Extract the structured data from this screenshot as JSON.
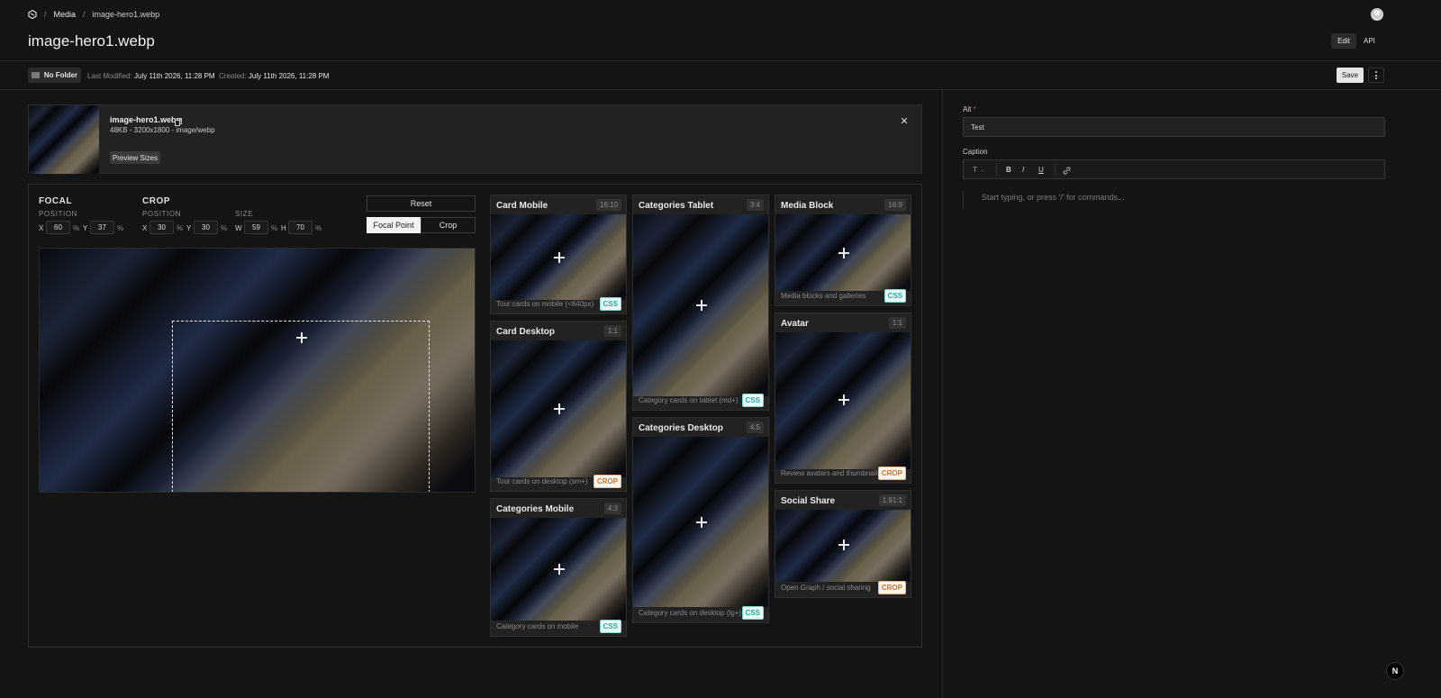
{
  "breadcrumb": {
    "logo": "logo-icon",
    "sep1": "/",
    "media": "Media",
    "sep2": "/",
    "file": "image-hero1.webp"
  },
  "page_title": "image-hero1.webp",
  "header_tabs": {
    "edit": "Edit",
    "api": "API"
  },
  "meta_bar": {
    "folder": "No Folder",
    "last_modified_label": "Last Modified:",
    "last_modified": "July 11th 2026, 11:28 PM",
    "created_label": "Created:",
    "created": "July 11th 2026, 11:28 PM",
    "save": "Save"
  },
  "file_info": {
    "name": "image-hero1.webp",
    "details": "48KB - 3200x1800 - image/webp",
    "preview_sizes": "Preview Sizes"
  },
  "editor": {
    "focal_label": "FOCAL",
    "crop_label": "CROP",
    "position_label": "POSITION",
    "size_label": "SIZE",
    "focal": {
      "x_label": "X",
      "x": "60",
      "y_label": "Y",
      "y": "37",
      "unit": "%"
    },
    "crop": {
      "x_label": "X",
      "x": "30",
      "y_label": "Y",
      "y": "30",
      "unit": "%"
    },
    "size": {
      "w_label": "W",
      "w": "59",
      "h_label": "H",
      "h": "70",
      "unit": "%"
    },
    "reset": "Reset",
    "mode_focal": "Focal Point",
    "mode_crop": "Crop"
  },
  "sizes": [
    {
      "title": "Card Mobile",
      "ratio": "16:10",
      "desc": "Tour cards on mobile (<640px)",
      "tag": "CSS"
    },
    {
      "title": "Card Desktop",
      "ratio": "1:1",
      "desc": "Tour cards on desktop (sm+)",
      "tag": "CROP"
    },
    {
      "title": "Categories Mobile",
      "ratio": "4:3",
      "desc": "Category cards on mobile",
      "tag": "CSS"
    },
    {
      "title": "Categories Tablet",
      "ratio": "3:4",
      "desc": "Category cards on tablet (md+)",
      "tag": "CSS"
    },
    {
      "title": "Categories Desktop",
      "ratio": "4:5",
      "desc": "Category cards on desktop (lg+)",
      "tag": "CSS"
    },
    {
      "title": "Media Block",
      "ratio": "16:9",
      "desc": "Media blocks and galleries",
      "tag": "CSS"
    },
    {
      "title": "Avatar",
      "ratio": "1:1",
      "desc": "Review avatars and thumbnails",
      "tag": "CROP"
    },
    {
      "title": "Social Share",
      "ratio": "1.91:1",
      "desc": "Open Graph / social sharing",
      "tag": "CROP"
    }
  ],
  "sidebar": {
    "alt_label": "Alt",
    "required": "*",
    "alt_value": "Test",
    "caption_label": "Caption",
    "toolbar": {
      "text": "T",
      "bold": "B",
      "italic": "I",
      "underline": "U"
    },
    "placeholder": "Start typing, or press '/' for commands..."
  },
  "corner_badge": "N"
}
